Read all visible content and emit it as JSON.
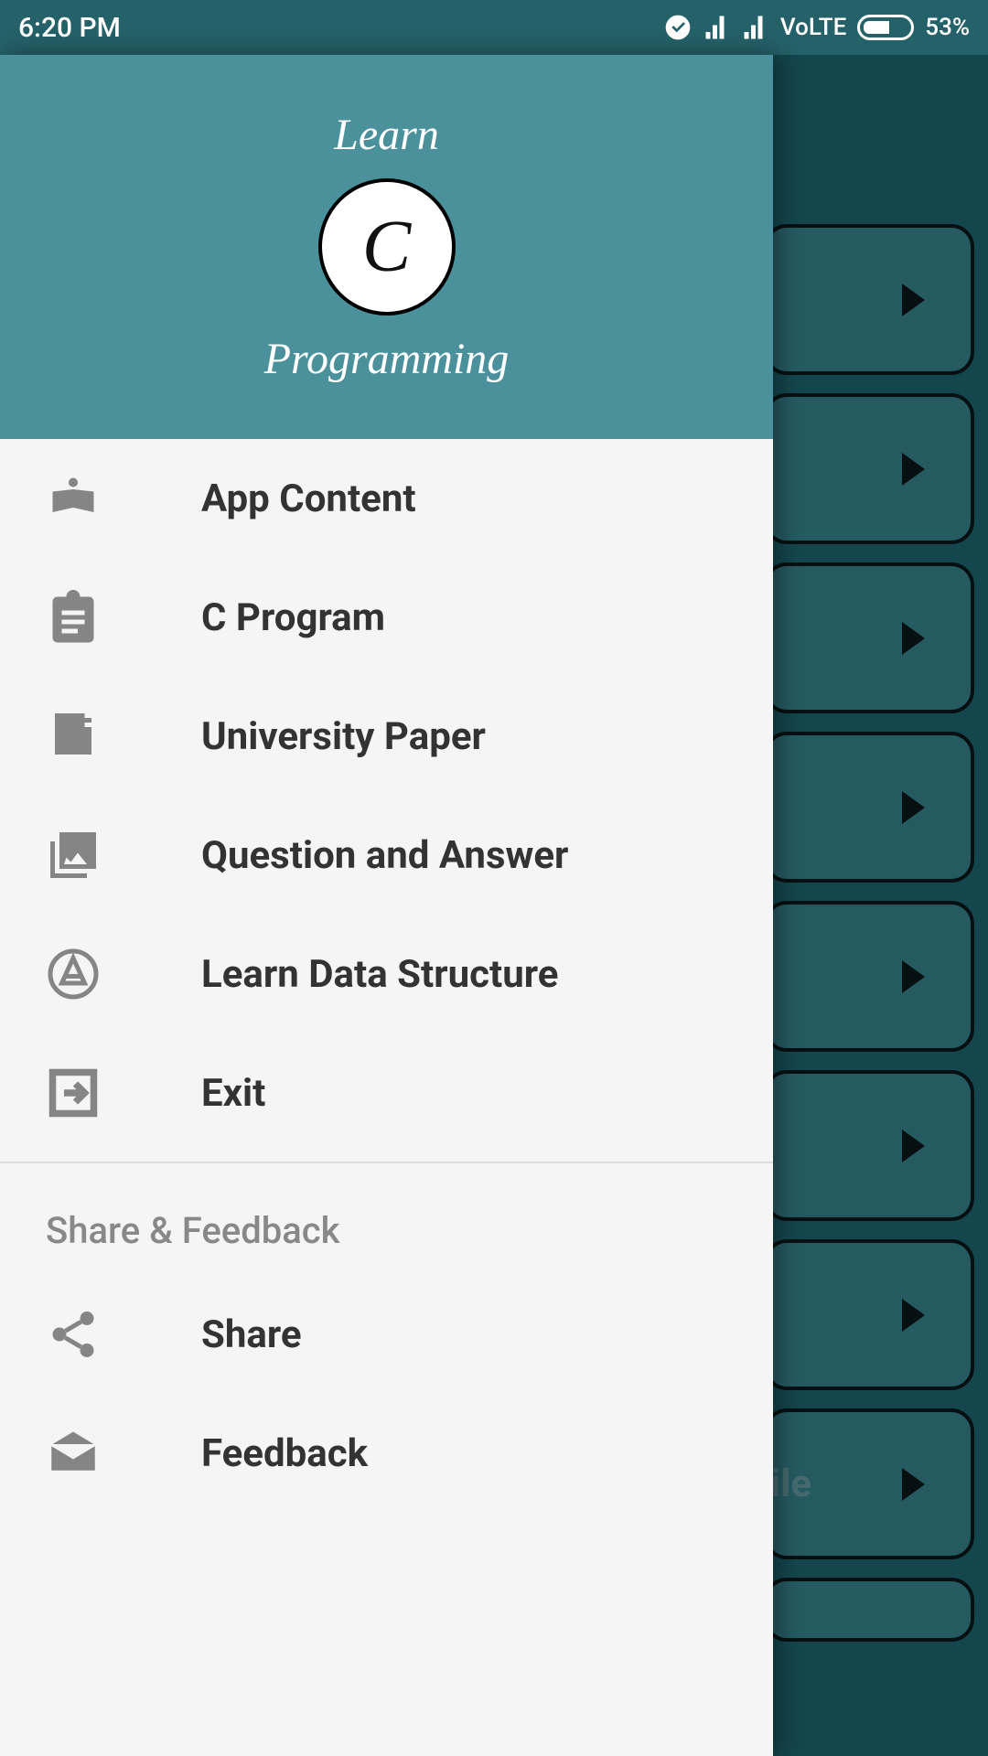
{
  "status": {
    "time": "6:20 PM",
    "volte": "VoLTE",
    "battery": "53%"
  },
  "drawer": {
    "header": {
      "learn": "Learn",
      "c": "C",
      "programming": "Programming"
    },
    "menu": [
      {
        "label": "App Content"
      },
      {
        "label": "C Program"
      },
      {
        "label": "University Paper"
      },
      {
        "label": "Question and Answer"
      },
      {
        "label": "Learn Data Structure"
      },
      {
        "label": "Exit"
      }
    ],
    "section_title": "Share & Feedback",
    "secondary": [
      {
        "label": "Share"
      },
      {
        "label": "Feedback"
      }
    ]
  },
  "background": {
    "file_label": "File"
  }
}
